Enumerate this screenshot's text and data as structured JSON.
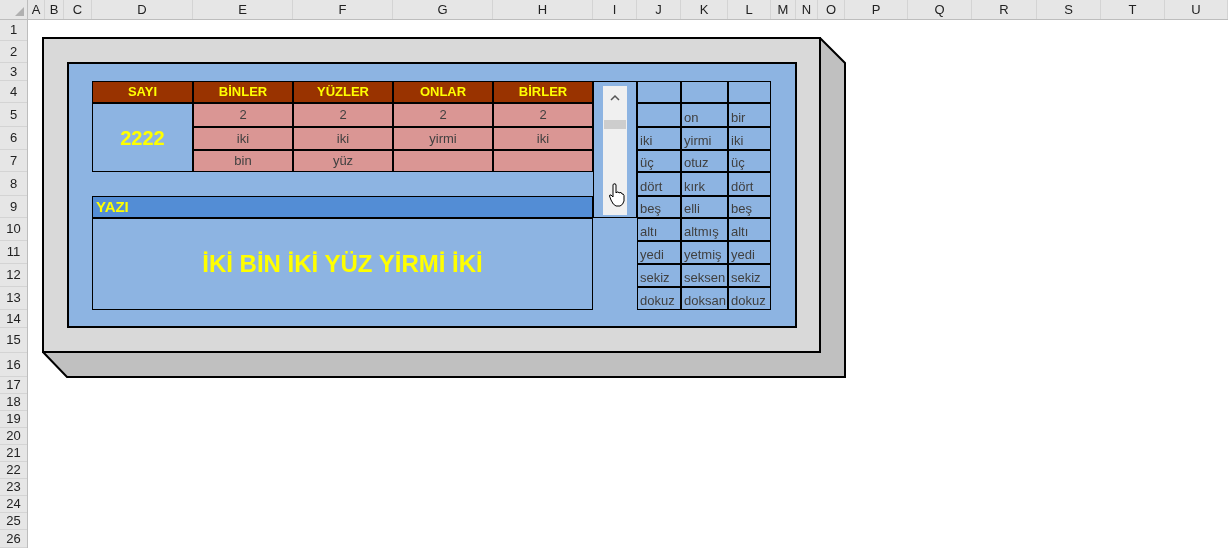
{
  "sheet": {
    "columns": [
      "A",
      "B",
      "C",
      "D",
      "E",
      "F",
      "G",
      "H",
      "I",
      "J",
      "K",
      "L",
      "M",
      "N",
      "O",
      "P",
      "Q",
      "R",
      "S",
      "T",
      "U"
    ],
    "rows": [
      "1",
      "2",
      "3",
      "4",
      "5",
      "6",
      "7",
      "8",
      "9",
      "10",
      "11",
      "12",
      "13",
      "14",
      "15",
      "16",
      "17",
      "18",
      "19",
      "20",
      "21",
      "22",
      "23",
      "24",
      "25",
      "26"
    ]
  },
  "table": {
    "headers": [
      "SAYI",
      "BİNLER",
      "YÜZLER",
      "ONLAR",
      "BİRLER"
    ],
    "number": "2222",
    "digit_rows": [
      [
        "2",
        "2",
        "2",
        "2"
      ],
      [
        "iki",
        "iki",
        "yirmi",
        "iki"
      ],
      [
        "bin",
        "yüz"
      ]
    ]
  },
  "result": {
    "label": "YAZI",
    "text": "İKİ BİN İKİ YÜZ YİRMİ İKİ"
  },
  "word_table": {
    "columns": [
      {
        "words": [
          "iki",
          "üç",
          "dört",
          "beş",
          "altı",
          "yedi",
          "sekiz",
          "dokuz"
        ]
      },
      {
        "words": [
          "on",
          "yirmi",
          "otuz",
          "kırk",
          "elli",
          "altmış",
          "yetmiş",
          "seksen",
          "doksan"
        ]
      },
      {
        "words": [
          "bir",
          "iki",
          "üç",
          "dört",
          "beş",
          "altı",
          "yedi",
          "sekiz",
          "dokuz"
        ]
      }
    ]
  }
}
